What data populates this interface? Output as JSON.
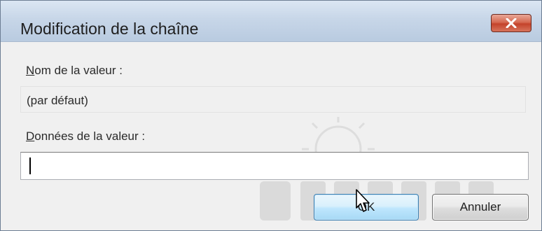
{
  "window": {
    "title": "Modification de la chaîne",
    "close_icon": "close-icon"
  },
  "form": {
    "name_label_accel": "N",
    "name_label_rest": "om de la valeur :",
    "name_value": "(par défaut)",
    "data_label_accel": "D",
    "data_label_rest": "onnées de la valeur :",
    "data_value": ""
  },
  "buttons": {
    "ok_label": "OK",
    "cancel_label": "Annuler"
  },
  "colors": {
    "title_bar": "#c7d6e8",
    "close_button": "#c4432b",
    "ok_button_border": "#3c7fb1",
    "dialog_background": "#f0f0f0"
  },
  "icons": [
    "close-icon",
    "mouse-pointer-icon"
  ]
}
